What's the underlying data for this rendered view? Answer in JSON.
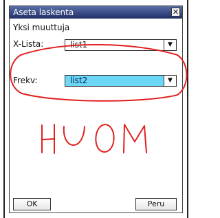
{
  "dialog": {
    "title": "Aseta laskenta",
    "close_glyph": "✕",
    "heading": "Yksi muuttuja"
  },
  "fields": {
    "x_list": {
      "label": "X-Lista:",
      "value": "list1"
    },
    "frequency": {
      "label": "Frekv:",
      "value": "list2"
    }
  },
  "buttons": {
    "ok": "OK",
    "cancel": "Peru"
  },
  "annotation": {
    "handwritten_text": "HUOM",
    "color": "#e0201e"
  },
  "colors": {
    "titlebar_top": "#5a6ea6",
    "titlebar_bottom": "#1f2f67",
    "selected_field": "#6cd6f5"
  },
  "icons": {
    "dropdown_arrow": "▼",
    "close": "close-icon"
  }
}
